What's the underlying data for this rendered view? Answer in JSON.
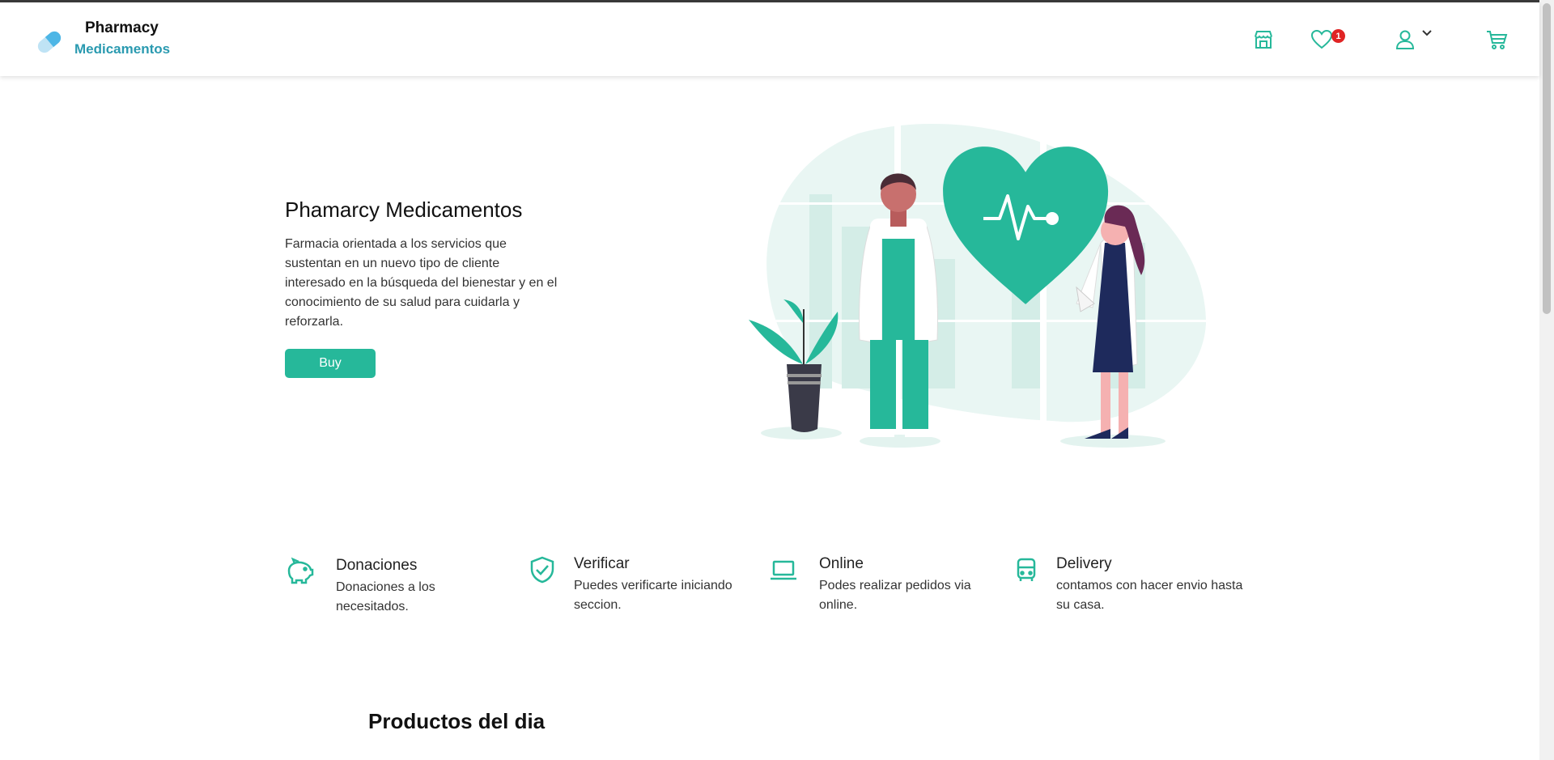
{
  "brand": {
    "name": "Pharmacy",
    "tagline": "Medicamentos"
  },
  "header": {
    "icons": [
      "store-icon",
      "heart-icon",
      "user-icon",
      "chevron-down-icon",
      "cart-icon"
    ],
    "favorites_count": "1",
    "accent_color": "#26b89a"
  },
  "hero": {
    "title": "Phamarcy Medicamentos",
    "description": "Farmacia orientada a los servicios que sustentan en un nuevo tipo de cliente interesado en la búsqueda del bienestar y en el conocimiento de su salud para cuidarla y reforzarla.",
    "button_label": "Buy"
  },
  "features": [
    {
      "icon": "piggy-bank-icon",
      "title": "Donaciones",
      "description": "Donaciones a los necesitados."
    },
    {
      "icon": "shield-check-icon",
      "title": "Verificar",
      "description": "Puedes verificarte iniciando seccion."
    },
    {
      "icon": "laptop-icon",
      "title": "Online",
      "description": "Podes realizar pedidos via online."
    },
    {
      "icon": "bus-icon",
      "title": "Delivery",
      "description": "contamos con hacer envio hasta su casa."
    }
  ],
  "products_section": {
    "title": "Productos del dia"
  }
}
